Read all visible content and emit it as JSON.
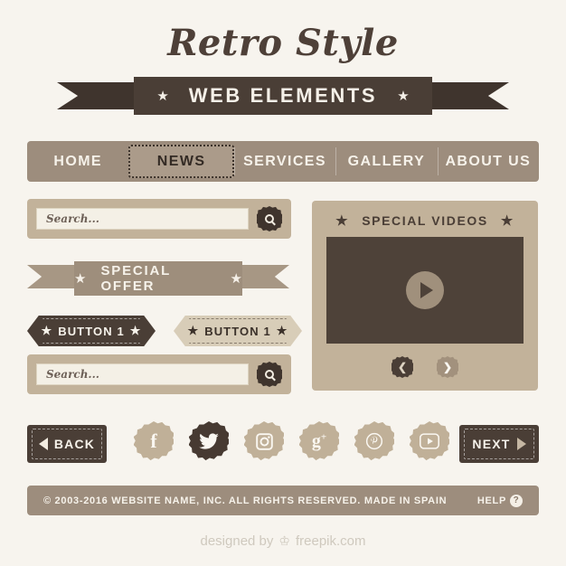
{
  "header": {
    "title_script": "Retro Style",
    "ribbon_label": "WEB ELEMENTS",
    "star_left": "★",
    "star_right": "★"
  },
  "nav": {
    "items": [
      {
        "label": "HOME",
        "active": false
      },
      {
        "label": "NEWS",
        "active": true
      },
      {
        "label": "SERVICES",
        "active": false
      },
      {
        "label": "GALLERY",
        "active": false
      },
      {
        "label": "ABOUT US",
        "active": false
      }
    ]
  },
  "search": {
    "top": {
      "placeholder": "Search...",
      "value": "",
      "button_icon": "search-icon"
    },
    "bottom": {
      "placeholder": "Search...",
      "value": "",
      "button_icon": "search-icon"
    }
  },
  "offer": {
    "label": "SPECIAL OFFER",
    "star_left": "★",
    "star_right": "★"
  },
  "buttons": {
    "dark": {
      "label": "BUTTON 1",
      "star_left": "★",
      "star_right": "★"
    },
    "light": {
      "label": "BUTTON 1",
      "star_left": "★",
      "star_right": "★"
    }
  },
  "video": {
    "title": "SPECIAL VIDEOS",
    "star_left": "★",
    "star_right": "★",
    "play_icon": "play-icon",
    "prev_label": "❮",
    "next_label": "❯"
  },
  "social": {
    "items": [
      {
        "name": "facebook",
        "glyph": "f",
        "dark": false
      },
      {
        "name": "twitter",
        "glyph": "",
        "dark": true
      },
      {
        "name": "instagram",
        "glyph": "",
        "dark": false
      },
      {
        "name": "googleplus",
        "glyph": "g",
        "dark": false
      },
      {
        "name": "pinterest",
        "glyph": "",
        "dark": false
      },
      {
        "name": "youtube",
        "glyph": "",
        "dark": false
      }
    ]
  },
  "pager": {
    "back_label": "BACK",
    "next_label": "NEXT"
  },
  "footer": {
    "copyright": "© 2003-2016 WEBSITE NAME, INC. ALL RIGHTS RESERVED. MADE IN SPAIN",
    "help_label": "HELP",
    "help_mark": "?"
  },
  "attribution": {
    "prefix": "designed by",
    "crown": "♔",
    "brand": "freepik.com"
  },
  "colors": {
    "page_bg": "#f7f4ee",
    "dark_brown": "#4a3e36",
    "ribbon_fold": "#2e2622",
    "tan": "#9d8d7d",
    "panel_tan": "#c2b29a",
    "cream": "#d8cdb8",
    "field_bg": "#f4f0e6",
    "text_light": "#f6f2ea"
  }
}
